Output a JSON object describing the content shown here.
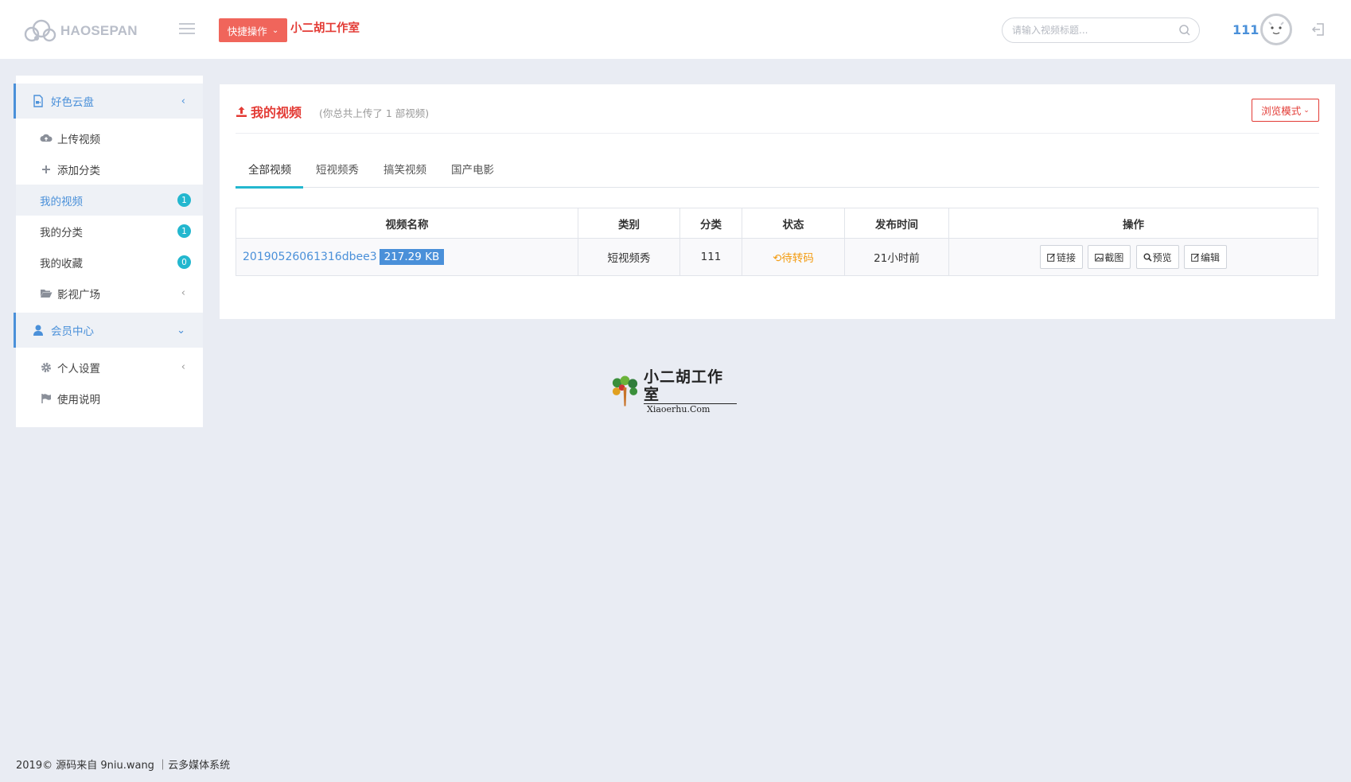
{
  "header": {
    "logo_text": "HAOSEPAN",
    "quick_action_label": "快捷操作",
    "studio_title": "小二胡工作室",
    "search_placeholder": "请输入视频标题...",
    "username": "111"
  },
  "sidebar": {
    "sections": [
      {
        "label": "好色云盘",
        "icon": "file-video-icon",
        "items": [
          {
            "label": "上传视频",
            "icon": "cloud-upload-icon"
          },
          {
            "label": "添加分类",
            "icon": "plus-icon"
          },
          {
            "label": "我的视频",
            "badge": "1",
            "active": true
          },
          {
            "label": "我的分类",
            "badge": "1"
          },
          {
            "label": "我的收藏",
            "badge": "0"
          },
          {
            "label": "影视广场",
            "icon": "folder-open-icon"
          }
        ]
      },
      {
        "label": "会员中心",
        "icon": "user-icon",
        "items": [
          {
            "label": "个人设置",
            "icon": "gear-icon"
          },
          {
            "label": "使用说明",
            "icon": "flag-icon"
          }
        ]
      }
    ]
  },
  "main": {
    "title": "我的视频",
    "subtitle": "(你总共上传了 1 部视频)",
    "browse_mode_label": "浏览模式",
    "tabs": [
      "全部视频",
      "短视频秀",
      "搞笑视频",
      "国产电影"
    ],
    "table": {
      "headers": [
        "视频名称",
        "类别",
        "分类",
        "状态",
        "发布时间",
        "操作"
      ],
      "rows": [
        {
          "name": "20190526061316dbee3",
          "size": "217.29 KB",
          "category": "短视频秀",
          "classification": "111",
          "status": "待转码",
          "published": "21小时前",
          "actions": [
            "链接",
            "截图",
            "预览",
            "编辑"
          ]
        }
      ]
    }
  },
  "watermark": {
    "cn": "小二胡工作室",
    "en": "Xiaoerhu.Com"
  },
  "footer": {
    "text": "2019© 源码来自 9niu.wang ｜云多媒体系统"
  },
  "colors": {
    "accent_red": "#e33b35",
    "quick_btn": "#f0655b",
    "link_blue": "#4a90d9",
    "badge_teal": "#23b7cf",
    "status_orange": "#f39c12",
    "background": "#e9ecf3"
  }
}
